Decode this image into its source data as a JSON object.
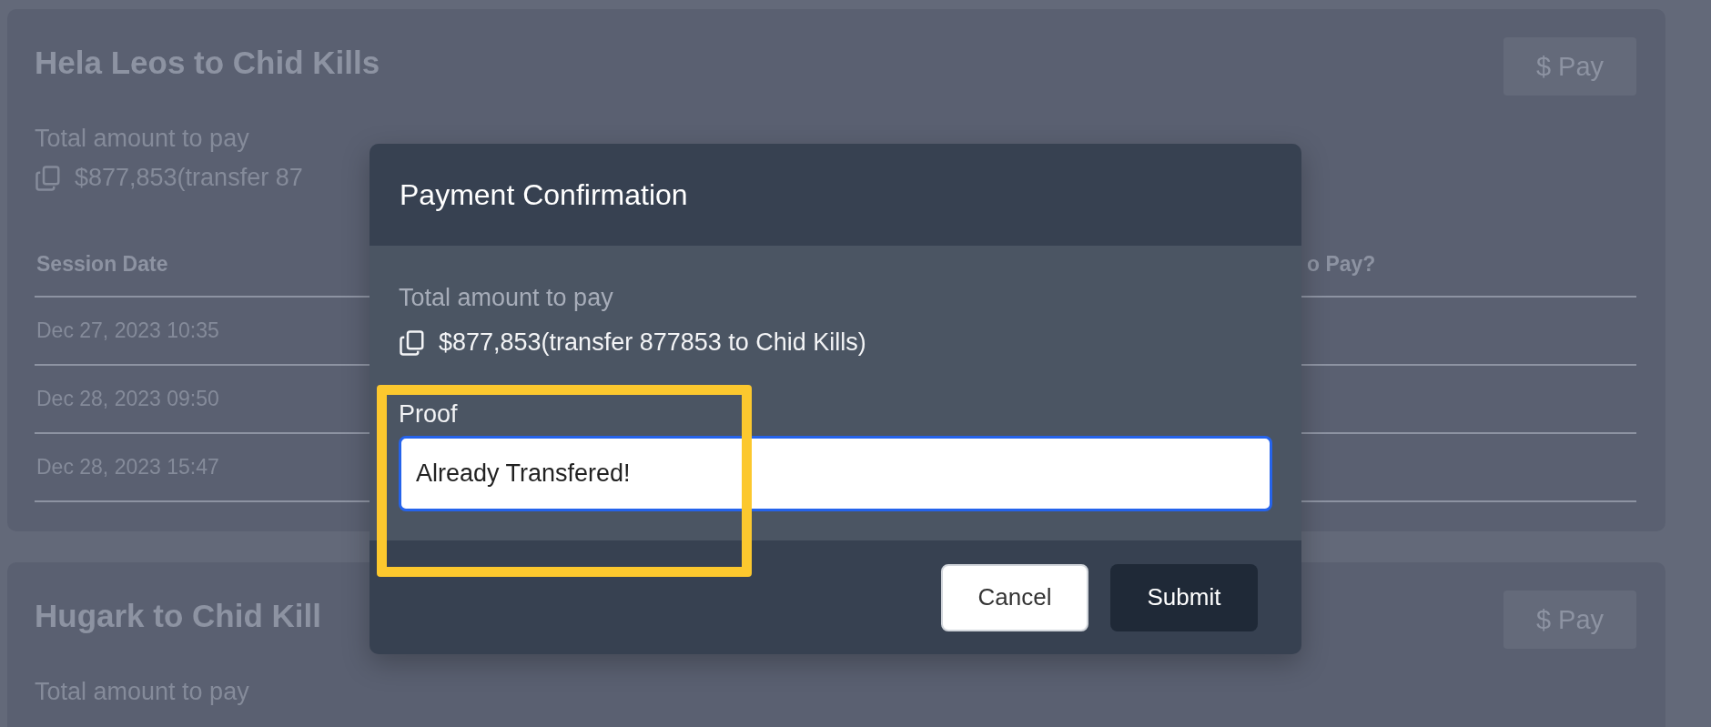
{
  "cards": [
    {
      "title": "Hela Leos to Chid Kills",
      "pay_button": "$ Pay",
      "total_label": "Total amount to pay",
      "amount": "$877,853(transfer 87",
      "table": {
        "columns": [
          "Session Date",
          "o Pay?"
        ],
        "rows": [
          [
            "Dec 27, 2023 10:35"
          ],
          [
            "Dec 28, 2023 09:50"
          ],
          [
            "Dec 28, 2023 15:47"
          ]
        ]
      }
    },
    {
      "title": "Hugark to Chid Kill",
      "pay_button": "$ Pay",
      "total_label": "Total amount to pay"
    }
  ],
  "dialog": {
    "title": "Payment Confirmation",
    "total_label": "Total amount to pay",
    "amount": "$877,853(transfer 877853 to Chid Kills)",
    "proof": {
      "label": "Proof",
      "value": "Already Transfered!",
      "focused": true
    },
    "buttons": [
      {
        "label": "Cancel",
        "kind": "secondary"
      },
      {
        "label": "Submit",
        "kind": "primary"
      }
    ]
  }
}
